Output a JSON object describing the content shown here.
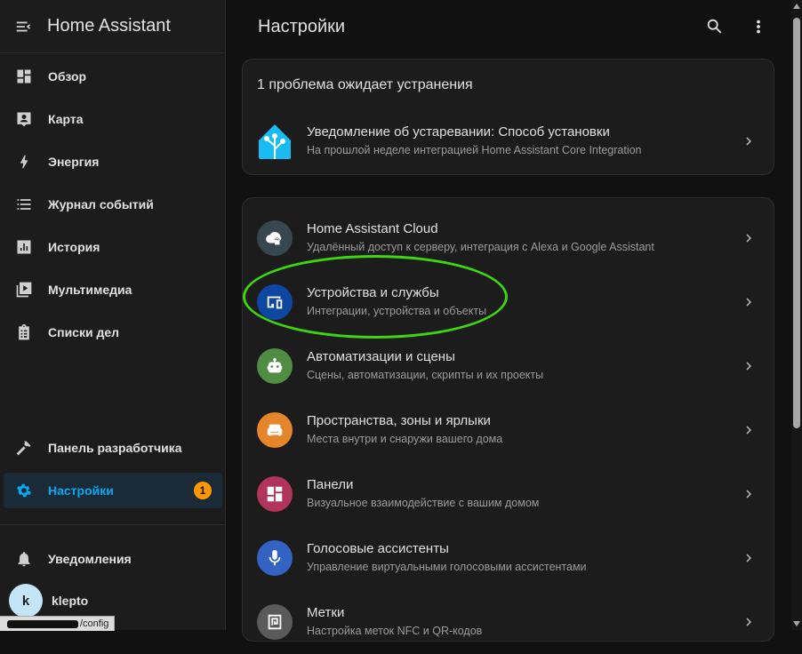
{
  "app": {
    "title": "Home Assistant"
  },
  "sidebar": {
    "items": [
      {
        "label": "Обзор",
        "icon": "dashboard-icon"
      },
      {
        "label": "Карта",
        "icon": "map-account-icon"
      },
      {
        "label": "Энергия",
        "icon": "lightning-icon"
      },
      {
        "label": "Журнал событий",
        "icon": "format-list-icon"
      },
      {
        "label": "История",
        "icon": "chart-box-icon"
      },
      {
        "label": "Мультимедиа",
        "icon": "play-box-icon"
      },
      {
        "label": "Списки дел",
        "icon": "clipboard-list-icon"
      }
    ],
    "developer": {
      "label": "Панель разработчика",
      "icon": "hammer-icon"
    },
    "settings": {
      "label": "Настройки",
      "icon": "cog-icon",
      "badge": "1"
    },
    "notifications": {
      "label": "Уведомления",
      "icon": "bell-icon"
    },
    "user": {
      "name": "klepto",
      "initial": "k"
    }
  },
  "status_bar": {
    "url_suffix": "/config"
  },
  "header": {
    "title": "Настройки"
  },
  "repairs": {
    "heading": "1 проблема ожидает устранения",
    "item": {
      "title": "Уведомление об устаревании: Способ установки",
      "subtitle": "На прошлой неделе интеграцией Home Assistant Core Integration"
    }
  },
  "menu": [
    {
      "title": "Home Assistant Cloud",
      "subtitle": "Удалённый доступ к серверу, интеграция с Alexa и Google Assistant",
      "color": "#37474f",
      "icon": "cloud-lock-icon"
    },
    {
      "title": "Устройства и службы",
      "subtitle": "Интеграции, устройства и объекты",
      "color": "#0d47a1",
      "icon": "devices-icon"
    },
    {
      "title": "Автоматизации и сцены",
      "subtitle": "Сцены, автоматизации, скрипты и их проекты",
      "color": "#518c43",
      "icon": "robot-icon"
    },
    {
      "title": "Пространства, зоны и ярлыки",
      "subtitle": "Места внутри и снаружи вашего дома",
      "color": "#e48629",
      "icon": "sofa-icon"
    },
    {
      "title": "Панели",
      "subtitle": "Визуальное взаимодействие с вашим домом",
      "color": "#b1345c",
      "icon": "view-dashboard-icon"
    },
    {
      "title": "Голосовые ассистенты",
      "subtitle": "Управление виртуальными голосовыми ассистентами",
      "color": "#3263c3",
      "icon": "microphone-icon"
    },
    {
      "title": "Метки",
      "subtitle": "Настройка меток NFC и QR-кодов",
      "color": "#5a5a5a",
      "icon": "nfc-icon"
    }
  ],
  "colors": {
    "accent": "#03a9f4",
    "badge": "#ff9800",
    "highlight": "#3ed60f"
  }
}
